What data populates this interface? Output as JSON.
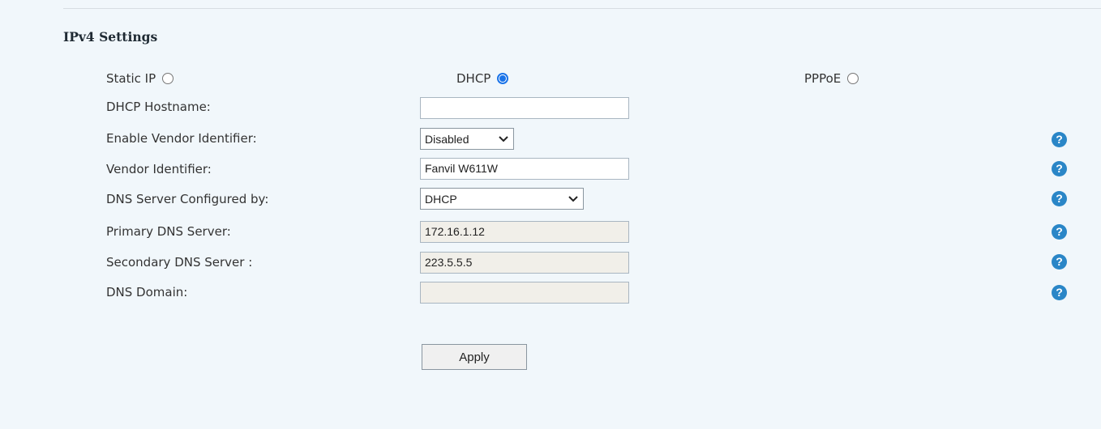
{
  "section": {
    "title": "IPv4 Settings"
  },
  "ip_mode": {
    "options": [
      {
        "label": "Static IP",
        "selected": false
      },
      {
        "label": "DHCP",
        "selected": true
      },
      {
        "label": "PPPoE",
        "selected": false
      }
    ]
  },
  "fields": {
    "dhcp_hostname": {
      "label": "DHCP Hostname:",
      "value": ""
    },
    "enable_vendor_identifier": {
      "label": "Enable Vendor Identifier:",
      "value": "Disabled"
    },
    "vendor_identifier": {
      "label": "Vendor Identifier:",
      "value": "Fanvil W611W"
    },
    "dns_configured_by": {
      "label": "DNS Server Configured by:",
      "value": "DHCP"
    },
    "primary_dns": {
      "label": "Primary DNS Server:",
      "value": "172.16.1.12"
    },
    "secondary_dns": {
      "label": "Secondary DNS Server :",
      "value": "223.5.5.5"
    },
    "dns_domain": {
      "label": "DNS Domain:",
      "value": ""
    }
  },
  "help_icon_glyph": "?",
  "apply": {
    "label": "Apply"
  },
  "colors": {
    "background": "#f1f7fb",
    "help_icon": "#2a86c7",
    "radio_selected": "#1a73e8",
    "readonly_field": "#f1efe9"
  }
}
